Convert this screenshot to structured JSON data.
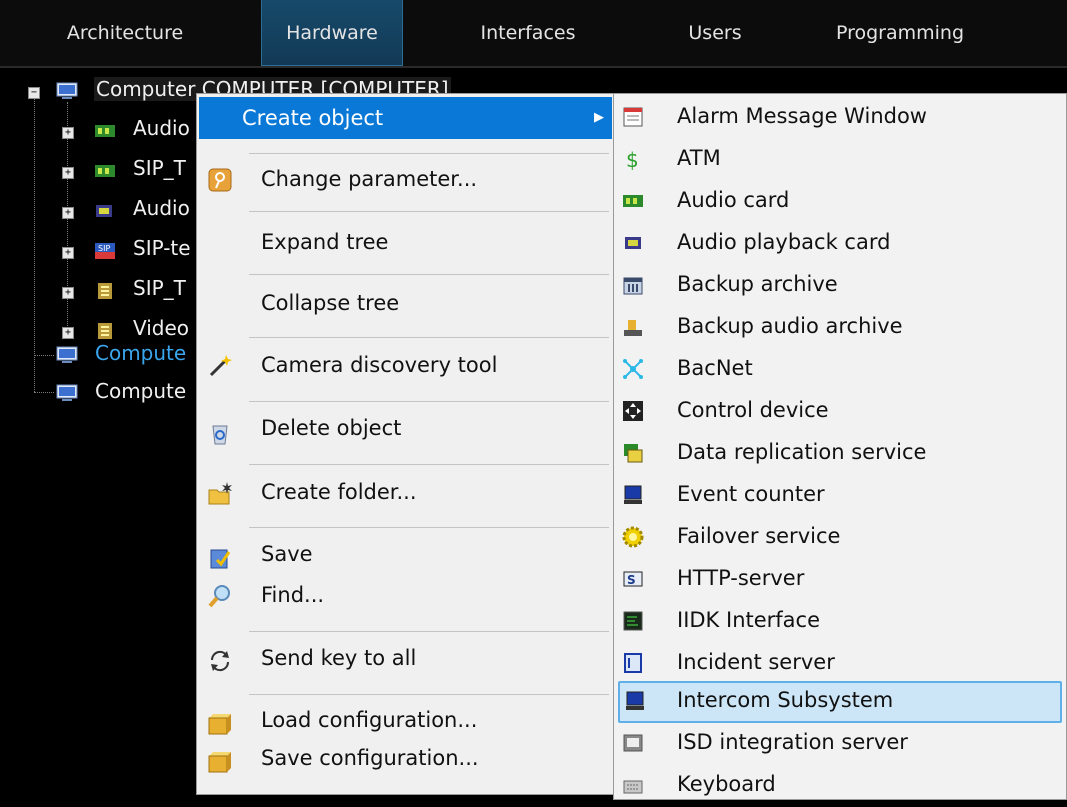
{
  "tabs": [
    {
      "label": "Architecture",
      "active": false
    },
    {
      "label": "Hardware",
      "active": true
    },
    {
      "label": "Interfaces",
      "active": false
    },
    {
      "label": "Users",
      "active": false
    },
    {
      "label": "Programming",
      "active": false
    }
  ],
  "tree": {
    "root": "Computer COMPUTER [COMPUTER]",
    "children": [
      "Audio",
      "SIP_T",
      "Audio",
      "SIP-te",
      "SIP_T",
      "Video"
    ],
    "siblings": [
      "Compute",
      "Compute"
    ]
  },
  "context_menu": {
    "header": "Create object",
    "items": [
      {
        "label": "Change parameter...",
        "icon": "key-icon"
      },
      {
        "label": "Expand tree",
        "icon": ""
      },
      {
        "label": "Collapse tree",
        "icon": ""
      },
      {
        "label": "Camera discovery tool",
        "icon": "magic-wand-icon"
      },
      {
        "label": "Delete object",
        "icon": "recycle-bin-icon"
      },
      {
        "label": "Create folder...",
        "icon": "new-folder-icon"
      },
      {
        "label": "Save",
        "icon": "save-icon"
      },
      {
        "label": "Find...",
        "icon": "magnifier-icon"
      },
      {
        "label": "Send key to all",
        "icon": "refresh-icon"
      },
      {
        "label": "Load configuration...",
        "icon": "load-box-icon"
      },
      {
        "label": "Save configuration...",
        "icon": "save-box-icon"
      }
    ]
  },
  "submenu": {
    "items": [
      {
        "label": "Alarm Message Window",
        "icon": "alarm-window-icon"
      },
      {
        "label": "ATM",
        "icon": "dollar-icon"
      },
      {
        "label": "Audio card",
        "icon": "audio-card-icon"
      },
      {
        "label": "Audio playback card",
        "icon": "playback-card-icon"
      },
      {
        "label": "Backup archive",
        "icon": "archive-icon"
      },
      {
        "label": "Backup audio archive",
        "icon": "audio-archive-icon"
      },
      {
        "label": "BacNet",
        "icon": "network-icon"
      },
      {
        "label": "Control device",
        "icon": "control-device-icon"
      },
      {
        "label": "Data replication service",
        "icon": "replication-icon"
      },
      {
        "label": "Event counter",
        "icon": "monitor-icon"
      },
      {
        "label": "Failover service",
        "icon": "gear-icon"
      },
      {
        "label": "HTTP-server",
        "icon": "http-server-icon"
      },
      {
        "label": "IIDK Interface",
        "icon": "terminal-icon"
      },
      {
        "label": "Incident server",
        "icon": "incident-server-icon"
      },
      {
        "label": "Intercom Subsystem",
        "icon": "intercom-icon",
        "highlighted": true
      },
      {
        "label": "ISD integration server",
        "icon": "isd-icon"
      },
      {
        "label": "Keyboard",
        "icon": "keyboard-icon"
      }
    ]
  }
}
